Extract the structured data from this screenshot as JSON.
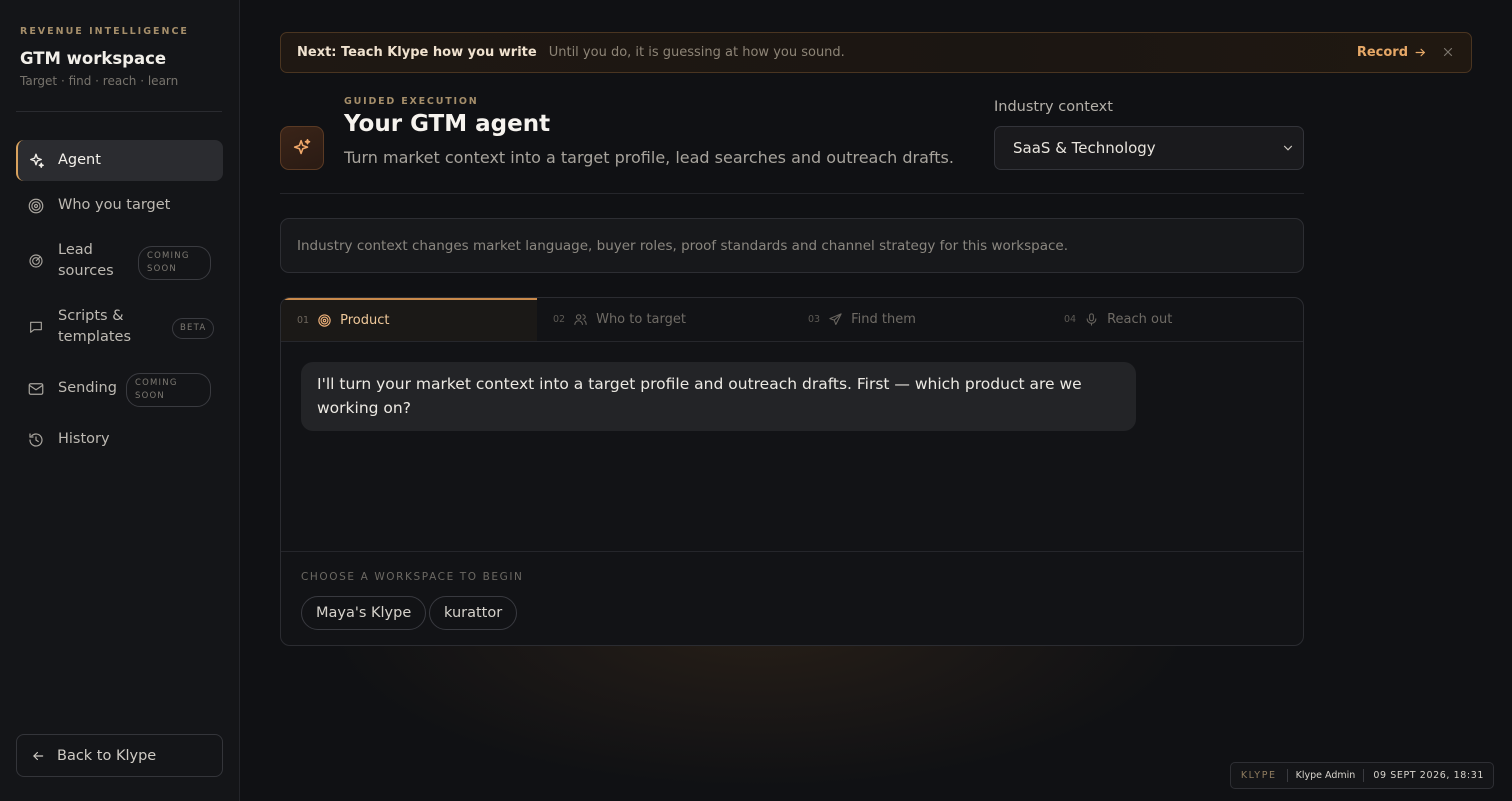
{
  "sidebar": {
    "kicker": "REVENUE INTELLIGENCE",
    "title": "GTM workspace",
    "subtitle": "Target · find · reach · learn",
    "items": [
      {
        "label": "Agent",
        "icon": "sparkle-icon",
        "active": true
      },
      {
        "label": "Who you target",
        "icon": "target-icon"
      },
      {
        "label": "Lead sources",
        "icon": "radar-icon",
        "badge": "COMING SOON"
      },
      {
        "label": "Scripts & templates",
        "icon": "chat-bubble-icon",
        "badge": "BETA"
      },
      {
        "label": "Sending",
        "icon": "mail-icon",
        "badge": "COMING SOON"
      },
      {
        "label": "History",
        "icon": "history-icon"
      }
    ],
    "back_label": "Back to Klype"
  },
  "banner": {
    "strong": "Next: Teach Klype how you write",
    "text": "Until you do, it is guessing at how you sound.",
    "action": "Record"
  },
  "header": {
    "kicker": "GUIDED EXECUTION",
    "title": "Your GTM agent",
    "lead": "Turn market context into a target profile, lead searches and outreach drafts.",
    "industry_label": "Industry context",
    "industry_value": "SaaS & Technology"
  },
  "note": "Industry context changes market language, buyer roles, proof standards and channel strategy for this workspace.",
  "steps": [
    {
      "num": "01",
      "label": "Product",
      "icon": "target-icon",
      "active": true
    },
    {
      "num": "02",
      "label": "Who to target",
      "icon": "users-icon"
    },
    {
      "num": "03",
      "label": "Find them",
      "icon": "send-icon"
    },
    {
      "num": "04",
      "label": "Reach out",
      "icon": "mic-icon"
    }
  ],
  "chat": {
    "message": "I'll turn your market context into a target profile and outreach drafts. First — which product are we working on?"
  },
  "workspace_prompt": "CHOOSE A WORKSPACE TO BEGIN",
  "workspaces": [
    "Maya's Klype",
    "kurattor"
  ],
  "footer": {
    "brand": "KLYPE",
    "user": "Klype Admin",
    "timestamp": "09 SEPT 2026, 18:31"
  },
  "colors": {
    "accent": "#e6a867",
    "background": "#101114",
    "sidebar": "#141518"
  }
}
